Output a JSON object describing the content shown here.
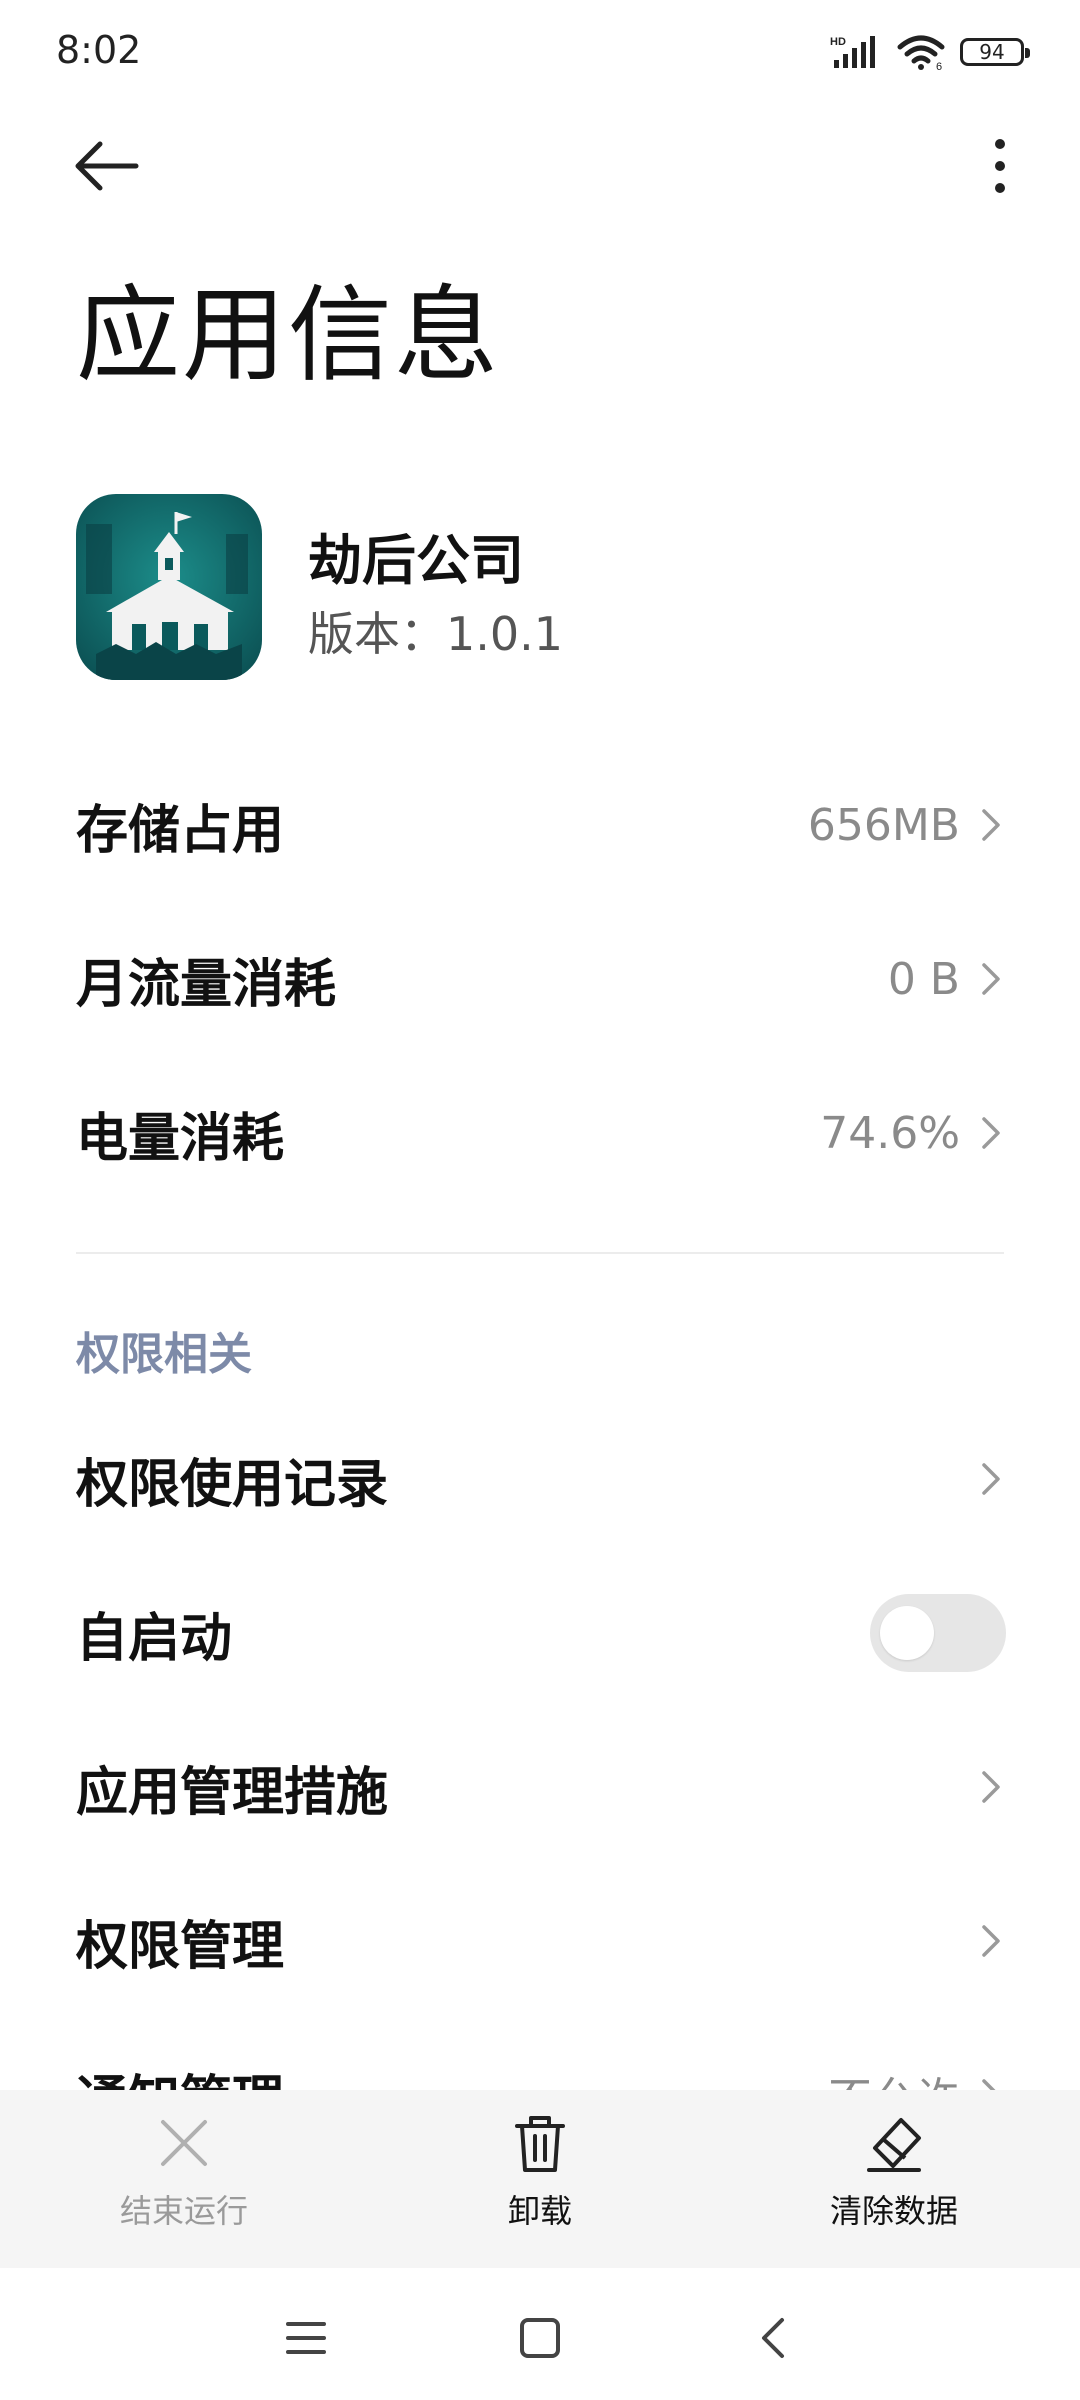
{
  "status_bar": {
    "time": "8:02",
    "battery": "94",
    "network_label": "HD"
  },
  "page": {
    "title": "应用信息"
  },
  "app": {
    "name": "劫后公司",
    "version": "版本：1.0.1"
  },
  "stats": [
    {
      "label": "存储占用",
      "value": "656MB"
    },
    {
      "label": "月流量消耗",
      "value": "0 B"
    },
    {
      "label": "电量消耗",
      "value": "74.6%"
    }
  ],
  "permissions": {
    "section_title": "权限相关",
    "items": [
      {
        "label": "权限使用记录"
      },
      {
        "label": "自启动",
        "toggle_on": false
      },
      {
        "label": "应用管理措施"
      },
      {
        "label": "权限管理"
      },
      {
        "label": "通知管理",
        "value": "不允许"
      }
    ]
  },
  "actions": {
    "stop": "结束运行",
    "uninstall": "卸载",
    "clear": "清除数据"
  },
  "colors": {
    "section_header": "#7d8aa8",
    "app_icon_bg": "#0f6b6a"
  },
  "icons": [
    "back-arrow-icon",
    "more-vert-icon",
    "chevron-right-icon",
    "close-icon",
    "trash-icon",
    "eraser-icon",
    "menu-icon",
    "home-square-icon",
    "nav-back-icon"
  ]
}
